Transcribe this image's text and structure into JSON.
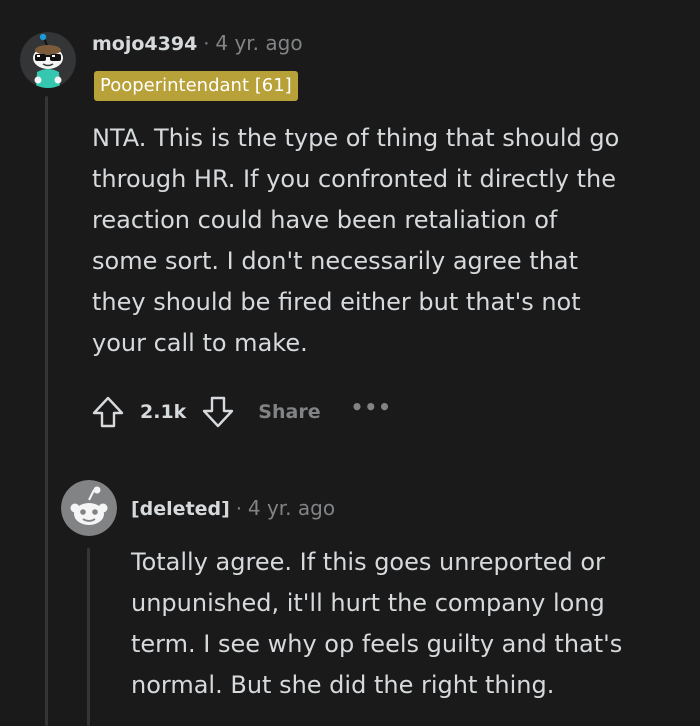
{
  "comment": {
    "username": "mojo4394",
    "separator": "·",
    "time": "4 yr. ago",
    "flair": "Pooperintendant [61]",
    "avatar_icon": "snoo-sunglasses-avatar-icon",
    "body_lines": [
      "NTA. This is the type of thing that should go",
      "through HR. If you confronted it directly the",
      "reaction could have been retaliation of",
      "some sort. I don't necessarily agree that",
      "they should be fired either but that's not",
      "your call to make."
    ],
    "actions": {
      "upvote_icon": "upvote-arrow-icon",
      "score": "2.1k",
      "downvote_icon": "downvote-arrow-icon",
      "share_label": "Share",
      "more_label": "•••"
    }
  },
  "reply": {
    "username": "[deleted]",
    "separator": "·",
    "time": "4 yr. ago",
    "avatar_icon": "default-snoo-avatar-icon",
    "body_lines": [
      "Totally agree. If this goes unreported or",
      "unpunished, it'll hurt the company long",
      "term. I see why op feels guilty and that's",
      "normal. But she did the right thing."
    ]
  },
  "colors": {
    "background": "#1a1a1b",
    "text": "#d7dadc",
    "meta": "#818384",
    "flair": "#b8a139",
    "thread_line": "#343536"
  }
}
